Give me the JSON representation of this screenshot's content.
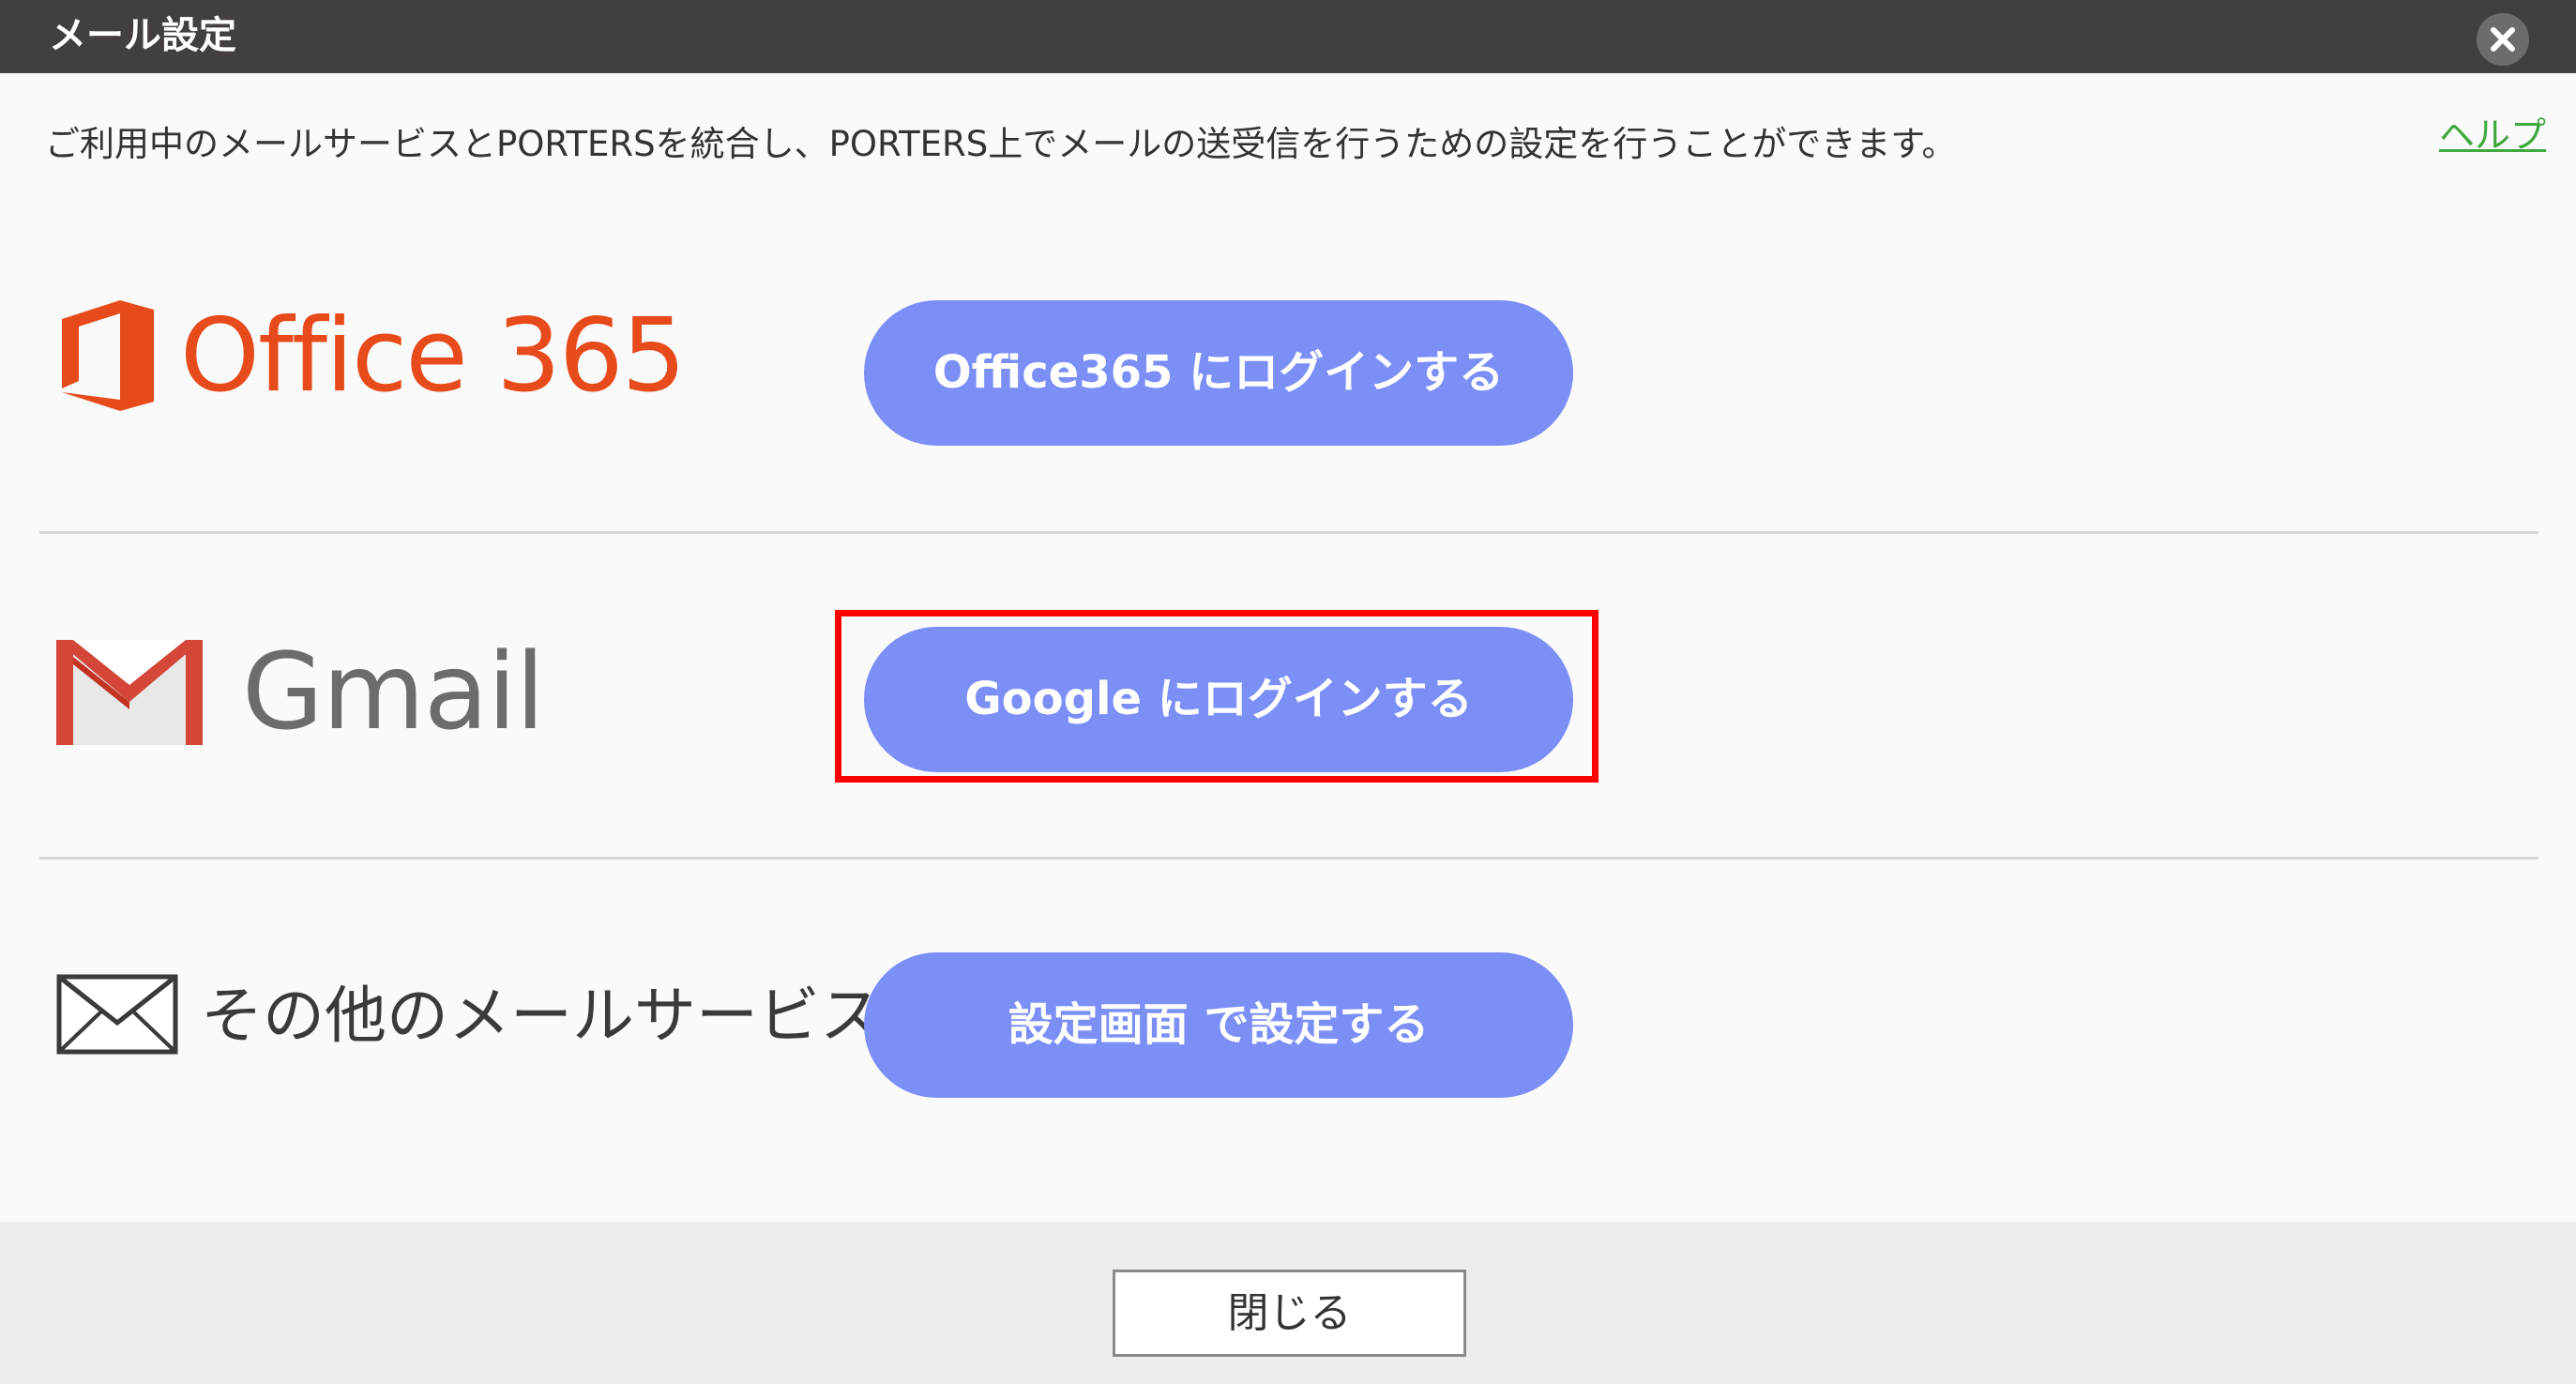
{
  "dialog": {
    "title": "メール設定",
    "description": "ご利用中のメールサービスとPORTERSを統合し、PORTERS上でメールの送受信を行うための設定を行うことができます。",
    "help_link": "ヘルプ"
  },
  "services": [
    {
      "name": "Office 365",
      "icon": "office365-logo-icon",
      "button_label": "Office365 にログインする"
    },
    {
      "name": "Gmail",
      "icon": "gmail-logo-icon",
      "button_label": "Google にログインする"
    },
    {
      "name": "その他のメールサービス",
      "icon": "envelope-icon",
      "button_label": "設定画面 で設定する"
    }
  ],
  "footer": {
    "close_label": "閉じる"
  },
  "colors": {
    "titlebar": "#433e3f",
    "button": "#7b8ff7",
    "office_brand": "#e74b1b",
    "gmail_red": "#d44638",
    "help_link": "#3ea93e",
    "highlight": "#ff0000"
  }
}
